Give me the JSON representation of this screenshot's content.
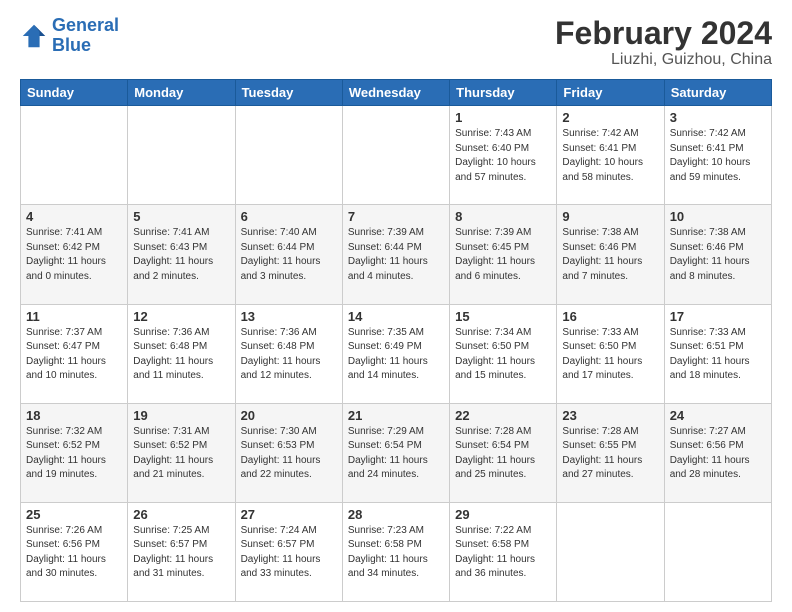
{
  "logo": {
    "text_general": "General",
    "text_blue": "Blue"
  },
  "title": "February 2024",
  "subtitle": "Liuzhi, Guizhou, China",
  "days_of_week": [
    "Sunday",
    "Monday",
    "Tuesday",
    "Wednesday",
    "Thursday",
    "Friday",
    "Saturday"
  ],
  "weeks": [
    [
      {
        "day": "",
        "info": ""
      },
      {
        "day": "",
        "info": ""
      },
      {
        "day": "",
        "info": ""
      },
      {
        "day": "",
        "info": ""
      },
      {
        "day": "1",
        "info": "Sunrise: 7:43 AM\nSunset: 6:40 PM\nDaylight: 10 hours\nand 57 minutes."
      },
      {
        "day": "2",
        "info": "Sunrise: 7:42 AM\nSunset: 6:41 PM\nDaylight: 10 hours\nand 58 minutes."
      },
      {
        "day": "3",
        "info": "Sunrise: 7:42 AM\nSunset: 6:41 PM\nDaylight: 10 hours\nand 59 minutes."
      }
    ],
    [
      {
        "day": "4",
        "info": "Sunrise: 7:41 AM\nSunset: 6:42 PM\nDaylight: 11 hours\nand 0 minutes."
      },
      {
        "day": "5",
        "info": "Sunrise: 7:41 AM\nSunset: 6:43 PM\nDaylight: 11 hours\nand 2 minutes."
      },
      {
        "day": "6",
        "info": "Sunrise: 7:40 AM\nSunset: 6:44 PM\nDaylight: 11 hours\nand 3 minutes."
      },
      {
        "day": "7",
        "info": "Sunrise: 7:39 AM\nSunset: 6:44 PM\nDaylight: 11 hours\nand 4 minutes."
      },
      {
        "day": "8",
        "info": "Sunrise: 7:39 AM\nSunset: 6:45 PM\nDaylight: 11 hours\nand 6 minutes."
      },
      {
        "day": "9",
        "info": "Sunrise: 7:38 AM\nSunset: 6:46 PM\nDaylight: 11 hours\nand 7 minutes."
      },
      {
        "day": "10",
        "info": "Sunrise: 7:38 AM\nSunset: 6:46 PM\nDaylight: 11 hours\nand 8 minutes."
      }
    ],
    [
      {
        "day": "11",
        "info": "Sunrise: 7:37 AM\nSunset: 6:47 PM\nDaylight: 11 hours\nand 10 minutes."
      },
      {
        "day": "12",
        "info": "Sunrise: 7:36 AM\nSunset: 6:48 PM\nDaylight: 11 hours\nand 11 minutes."
      },
      {
        "day": "13",
        "info": "Sunrise: 7:36 AM\nSunset: 6:48 PM\nDaylight: 11 hours\nand 12 minutes."
      },
      {
        "day": "14",
        "info": "Sunrise: 7:35 AM\nSunset: 6:49 PM\nDaylight: 11 hours\nand 14 minutes."
      },
      {
        "day": "15",
        "info": "Sunrise: 7:34 AM\nSunset: 6:50 PM\nDaylight: 11 hours\nand 15 minutes."
      },
      {
        "day": "16",
        "info": "Sunrise: 7:33 AM\nSunset: 6:50 PM\nDaylight: 11 hours\nand 17 minutes."
      },
      {
        "day": "17",
        "info": "Sunrise: 7:33 AM\nSunset: 6:51 PM\nDaylight: 11 hours\nand 18 minutes."
      }
    ],
    [
      {
        "day": "18",
        "info": "Sunrise: 7:32 AM\nSunset: 6:52 PM\nDaylight: 11 hours\nand 19 minutes."
      },
      {
        "day": "19",
        "info": "Sunrise: 7:31 AM\nSunset: 6:52 PM\nDaylight: 11 hours\nand 21 minutes."
      },
      {
        "day": "20",
        "info": "Sunrise: 7:30 AM\nSunset: 6:53 PM\nDaylight: 11 hours\nand 22 minutes."
      },
      {
        "day": "21",
        "info": "Sunrise: 7:29 AM\nSunset: 6:54 PM\nDaylight: 11 hours\nand 24 minutes."
      },
      {
        "day": "22",
        "info": "Sunrise: 7:28 AM\nSunset: 6:54 PM\nDaylight: 11 hours\nand 25 minutes."
      },
      {
        "day": "23",
        "info": "Sunrise: 7:28 AM\nSunset: 6:55 PM\nDaylight: 11 hours\nand 27 minutes."
      },
      {
        "day": "24",
        "info": "Sunrise: 7:27 AM\nSunset: 6:56 PM\nDaylight: 11 hours\nand 28 minutes."
      }
    ],
    [
      {
        "day": "25",
        "info": "Sunrise: 7:26 AM\nSunset: 6:56 PM\nDaylight: 11 hours\nand 30 minutes."
      },
      {
        "day": "26",
        "info": "Sunrise: 7:25 AM\nSunset: 6:57 PM\nDaylight: 11 hours\nand 31 minutes."
      },
      {
        "day": "27",
        "info": "Sunrise: 7:24 AM\nSunset: 6:57 PM\nDaylight: 11 hours\nand 33 minutes."
      },
      {
        "day": "28",
        "info": "Sunrise: 7:23 AM\nSunset: 6:58 PM\nDaylight: 11 hours\nand 34 minutes."
      },
      {
        "day": "29",
        "info": "Sunrise: 7:22 AM\nSunset: 6:58 PM\nDaylight: 11 hours\nand 36 minutes."
      },
      {
        "day": "",
        "info": ""
      },
      {
        "day": "",
        "info": ""
      }
    ]
  ]
}
